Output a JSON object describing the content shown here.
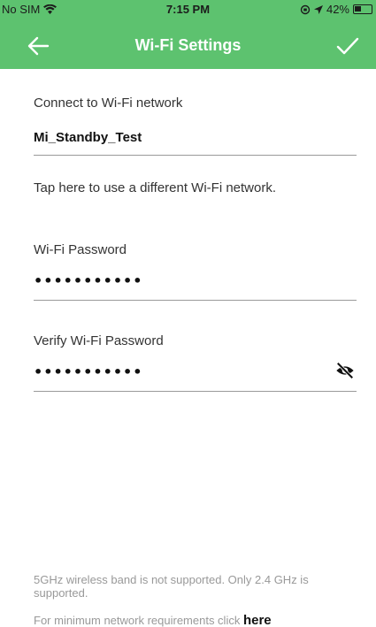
{
  "status_bar": {
    "carrier": "No SIM",
    "time": "7:15 PM",
    "battery_percent": "42%"
  },
  "nav": {
    "title": "Wi-Fi Settings",
    "back_icon": "arrow-left-icon",
    "confirm_icon": "check-icon"
  },
  "network": {
    "label": "Connect to Wi-Fi network",
    "value": "Mi_Standby_Test",
    "change_link": "Tap here to use a different Wi-Fi network."
  },
  "password": {
    "label": "Wi-Fi Password",
    "masked_value": "•••••••••••"
  },
  "verify_password": {
    "label": "Verify Wi-Fi Password",
    "masked_value": "•••••••••••",
    "toggle_icon": "eye-off-icon"
  },
  "footer": {
    "band_note": "5GHz wireless band is not supported. Only 2.4 GHz is supported.",
    "requirements_prefix": "For minimum network requirements click",
    "requirements_link": "here"
  },
  "colors": {
    "header": "#5dc26f",
    "header_text": "#ffffff"
  }
}
